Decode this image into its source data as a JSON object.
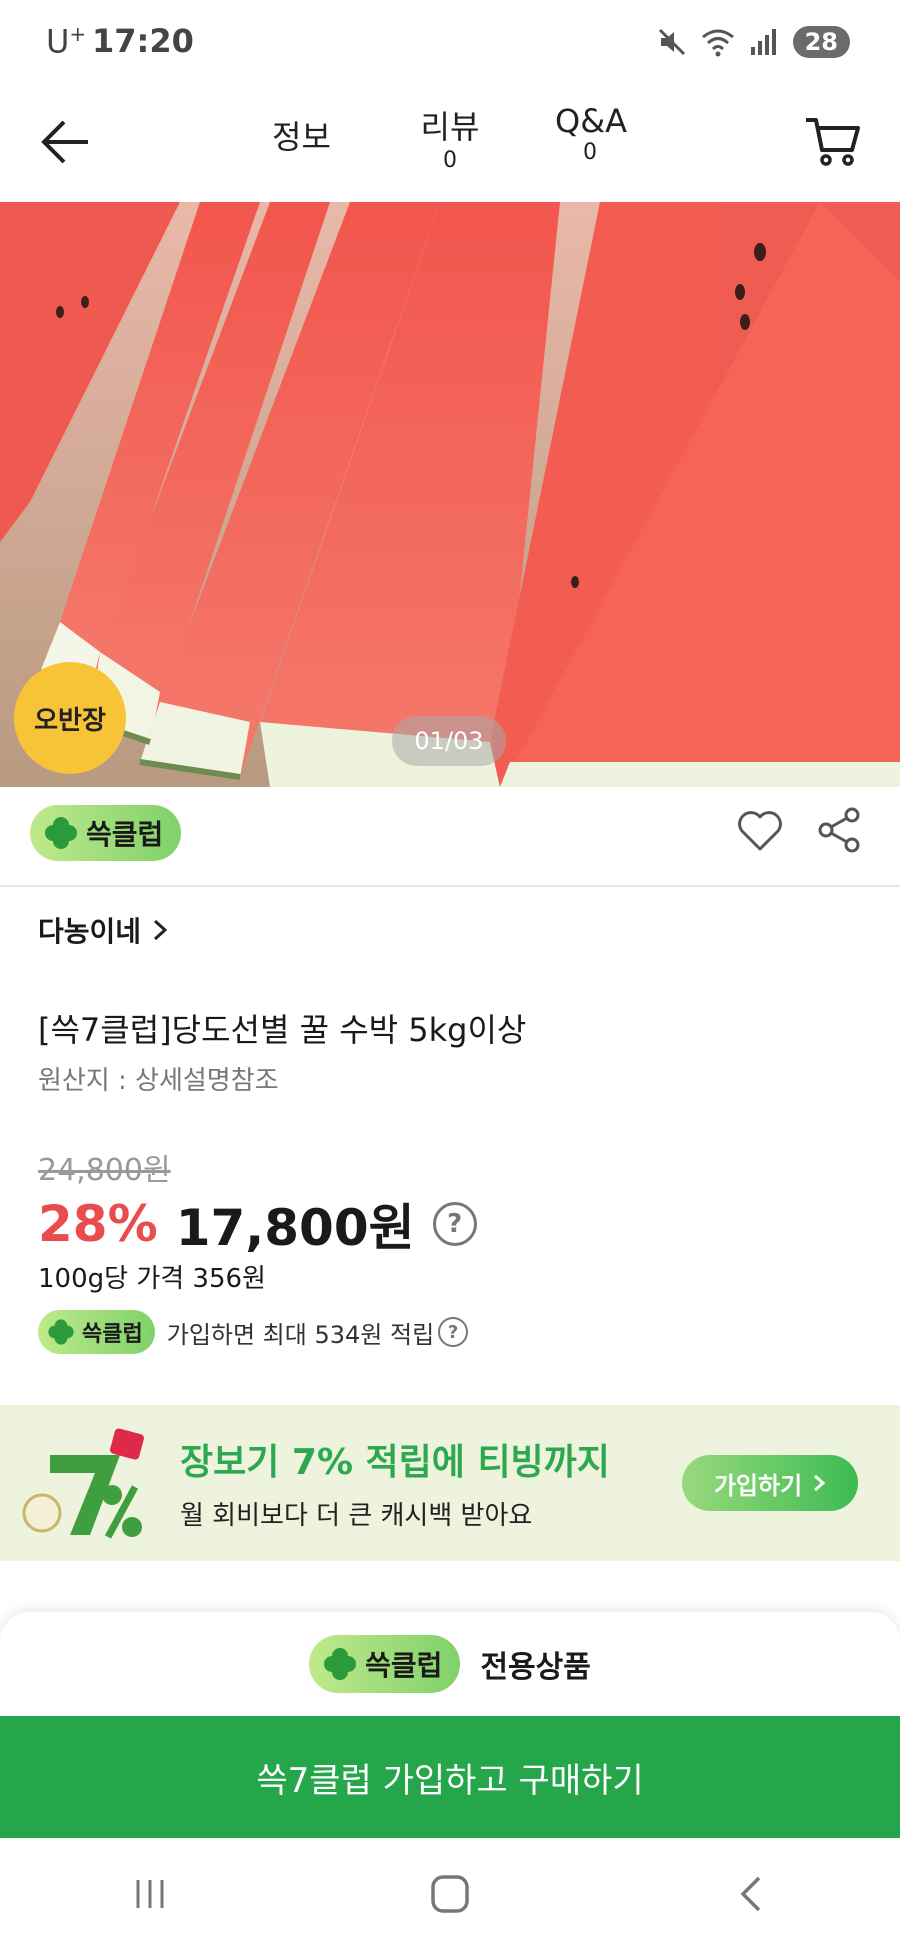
{
  "status_bar": {
    "carrier": "U",
    "carrier_plus": "+",
    "time": "17:20",
    "battery": "28"
  },
  "nav": {
    "tabs": [
      {
        "label": "정보",
        "count": ""
      },
      {
        "label": "리뷰",
        "count": "0"
      },
      {
        "label": "Q&A",
        "count": "0"
      }
    ]
  },
  "hero": {
    "badge": "오반장",
    "counter": "01/03"
  },
  "club": {
    "name": "쓱클럽"
  },
  "product": {
    "seller": "다농이네",
    "title": "[쓱7클럽]당도선별 꿀 수박 5kg이상",
    "origin": "원산지 : 상세설명참조",
    "original_price": "24,800원",
    "discount": "28%",
    "sale_price": "17,800원",
    "unit_price": "100g당 가격 356원",
    "reward_text": "가입하면 최대 534원 적립"
  },
  "promo": {
    "title": "장보기 7% 적립에 티빙까지",
    "subtitle": "월 회비보다 더 큰 캐시백 받아요",
    "button": "가입하기"
  },
  "sheet": {
    "exclusive": "전용상품",
    "buy_button": "쓱7클럽 가입하고 구매하기"
  }
}
